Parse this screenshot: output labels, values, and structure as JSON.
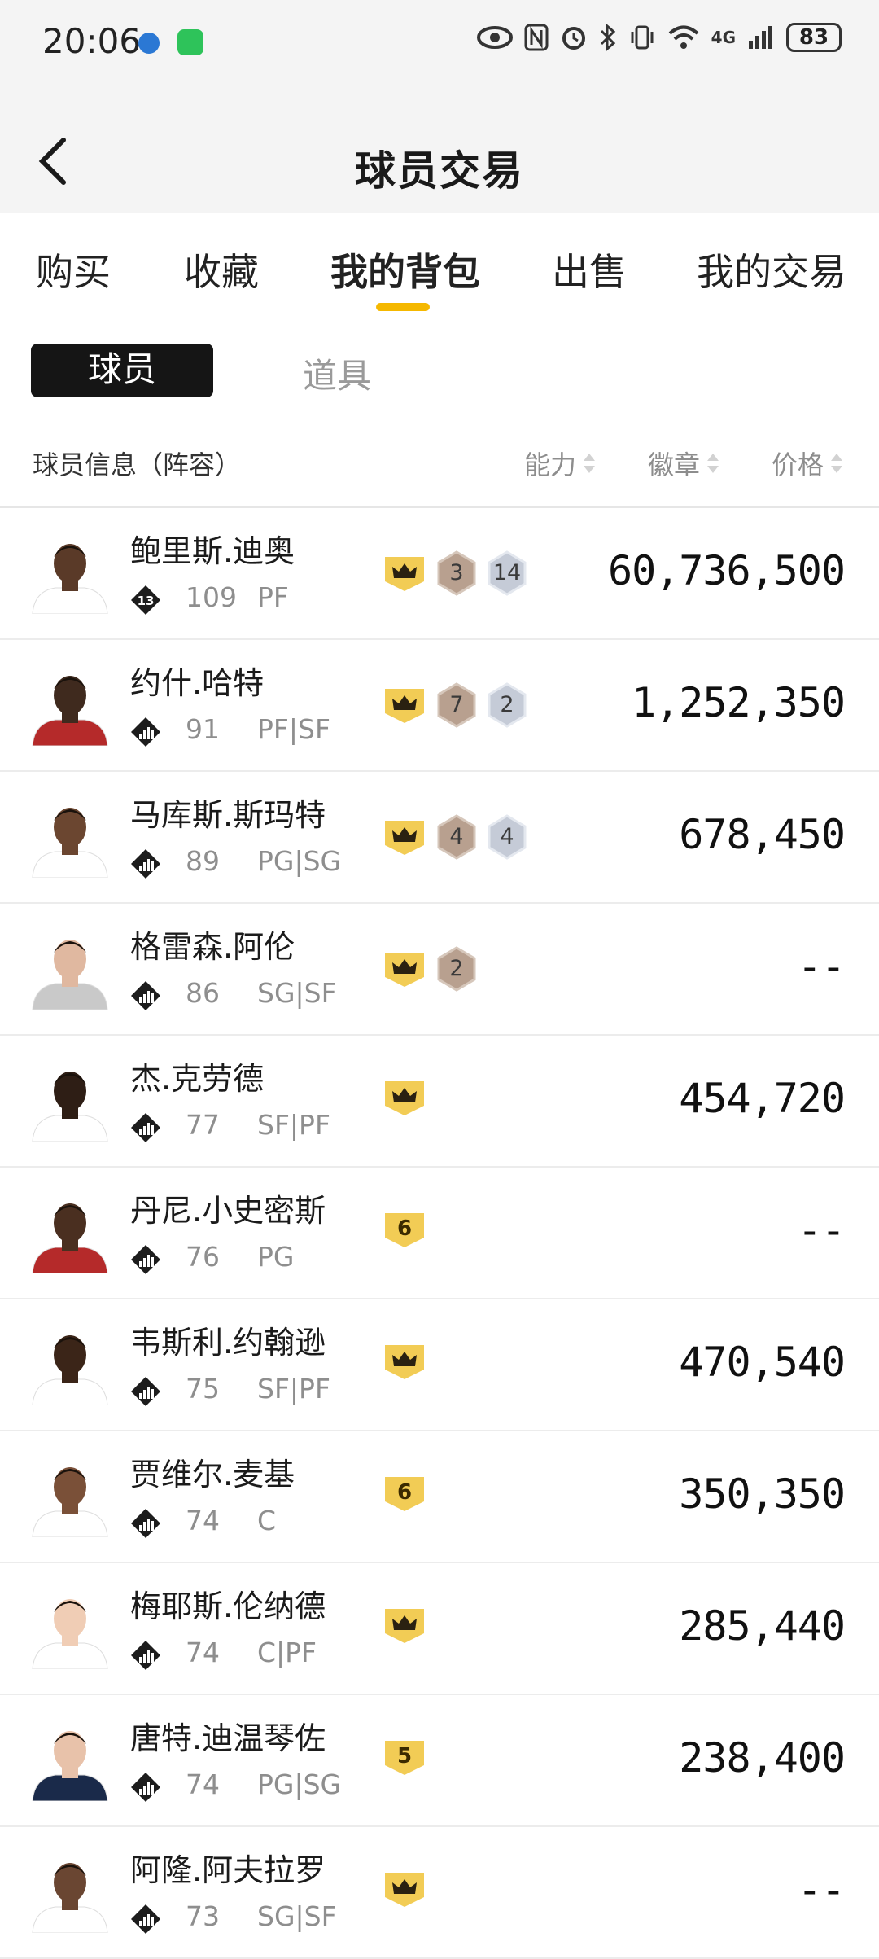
{
  "status": {
    "time": "20:06",
    "network": "4G",
    "battery": "83"
  },
  "nav": {
    "title": "球员交易"
  },
  "tabs": [
    {
      "label": "购买"
    },
    {
      "label": "收藏"
    },
    {
      "label": "我的背包"
    },
    {
      "label": "出售"
    },
    {
      "label": "我的交易"
    }
  ],
  "segment": {
    "player": "球员",
    "items": "道具"
  },
  "header": {
    "info": "球员信息（阵容）",
    "ability": "能力",
    "badge": "徽章",
    "price": "价格"
  },
  "colors": {
    "accent": "#f5b800",
    "segment_bg": "#151515",
    "badge_gold": "#f2cc55",
    "badge_bronze": "#b8a08f",
    "badge_silver": "#c5cbd7"
  },
  "players": [
    {
      "name": "鲍里斯.迪奥",
      "rank_icon": "diamond-13-icon",
      "rank": "13",
      "rating": "109",
      "position": "PF",
      "crown": "crown-icon",
      "bronze": "3",
      "silver": "14",
      "price": "60,736,500"
    },
    {
      "name": "约什.哈特",
      "rank_icon": "bars-icon",
      "rating": "91",
      "position": "PF|SF",
      "crown": "crown-icon",
      "bronze": "7",
      "silver": "2",
      "price": "1,252,350"
    },
    {
      "name": "马库斯.斯玛特",
      "rank_icon": "bars-icon",
      "rating": "89",
      "position": "PG|SG",
      "crown": "crown-icon",
      "bronze": "4",
      "silver": "4",
      "price": "678,450"
    },
    {
      "name": "格雷森.阿伦",
      "rank_icon": "bars-icon",
      "rating": "86",
      "position": "SG|SF",
      "crown": "crown-icon",
      "bronze": "2",
      "price": "--"
    },
    {
      "name": "杰.克劳德",
      "rank_icon": "bars-icon",
      "rating": "77",
      "position": "SF|PF",
      "crown": "crown-icon",
      "price": "454,720"
    },
    {
      "name": "丹尼.小史密斯",
      "rank_icon": "bars-icon",
      "rating": "76",
      "position": "PG",
      "level": "6",
      "price": "--"
    },
    {
      "name": "韦斯利.约翰逊",
      "rank_icon": "bars-icon",
      "rating": "75",
      "position": "SF|PF",
      "crown": "crown-icon",
      "price": "470,540"
    },
    {
      "name": "贾维尔.麦基",
      "rank_icon": "bars-icon",
      "rating": "74",
      "position": "C",
      "level": "6",
      "price": "350,350"
    },
    {
      "name": "梅耶斯.伦纳德",
      "rank_icon": "bars-icon",
      "rating": "74",
      "position": "C|PF",
      "crown": "crown-icon",
      "price": "285,440"
    },
    {
      "name": "唐特.迪温琴佐",
      "rank_icon": "bars-icon",
      "rating": "74",
      "position": "PG|SG",
      "level": "5",
      "price": "238,400"
    },
    {
      "name": "阿隆.阿夫拉罗",
      "rank_icon": "bars-icon",
      "rating": "73",
      "position": "SG|SF",
      "crown": "crown-icon",
      "price": "--"
    }
  ]
}
